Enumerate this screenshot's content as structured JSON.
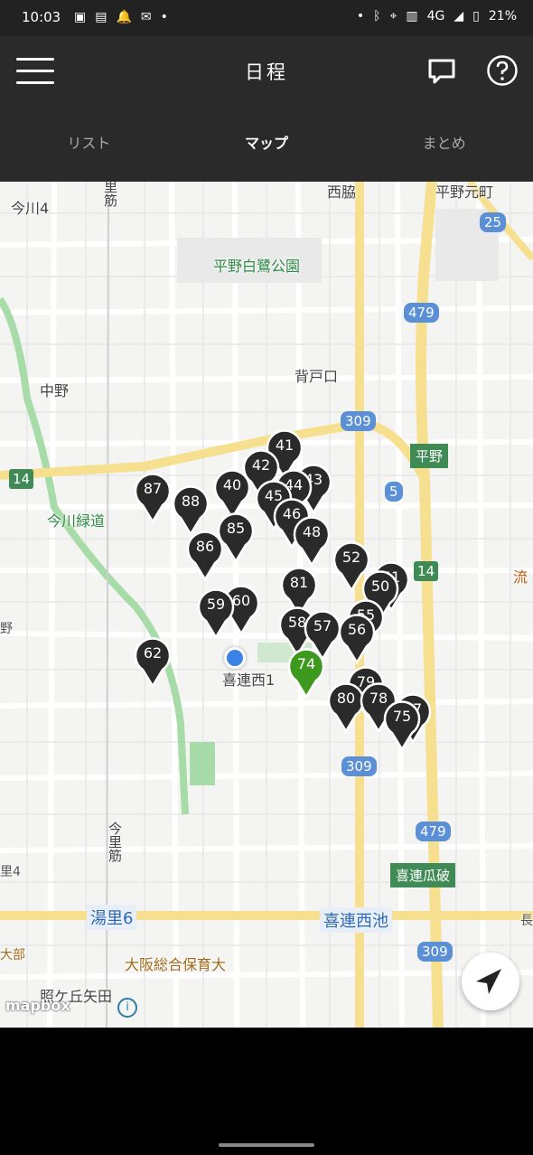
{
  "status_bar": {
    "time": "10:03",
    "network": "4G",
    "battery": "21%"
  },
  "app_bar": {
    "title": "日程"
  },
  "tabs": [
    {
      "label": "リスト"
    },
    {
      "label": "マップ",
      "active": true
    },
    {
      "label": "まとめ"
    }
  ],
  "map": {
    "labels": {
      "imagawa4": "今川4",
      "heiya_shirasagi": "平野白鷺公園",
      "senrokuchi": "背戸口",
      "nakano": "中野",
      "imagawa_ryokudo": "今川緑道",
      "kirenishi1": "喜連西1",
      "yuzato6": "湯里6",
      "kirenishiike": "喜連西池",
      "osaka_hoiku": "大阪総合保育大",
      "terugaoka": "照ケ丘矢田",
      "kire_uriwari": "喜連瓜破",
      "hirano_station": "平野",
      "nishiwaki": "西脇",
      "hirano_motomachi": "平野元町",
      "satoeki": "里筋",
      "imazato": "今里筋",
      "sato4": "里4",
      "daibu": "大部",
      "no": "野",
      "ryu": "流",
      "naga": "長"
    },
    "routes": [
      "25",
      "479",
      "309",
      "14",
      "5",
      "14",
      "309",
      "479",
      "309"
    ],
    "pins": [
      "41",
      "42",
      "43",
      "44",
      "40",
      "45",
      "87",
      "88",
      "46",
      "85",
      "48",
      "86",
      "52",
      "51",
      "50",
      "81",
      "60",
      "59",
      "58",
      "57",
      "55",
      "56",
      "62",
      "74",
      "79",
      "80",
      "78",
      "77",
      "75"
    ],
    "attribution": "mapbox"
  }
}
